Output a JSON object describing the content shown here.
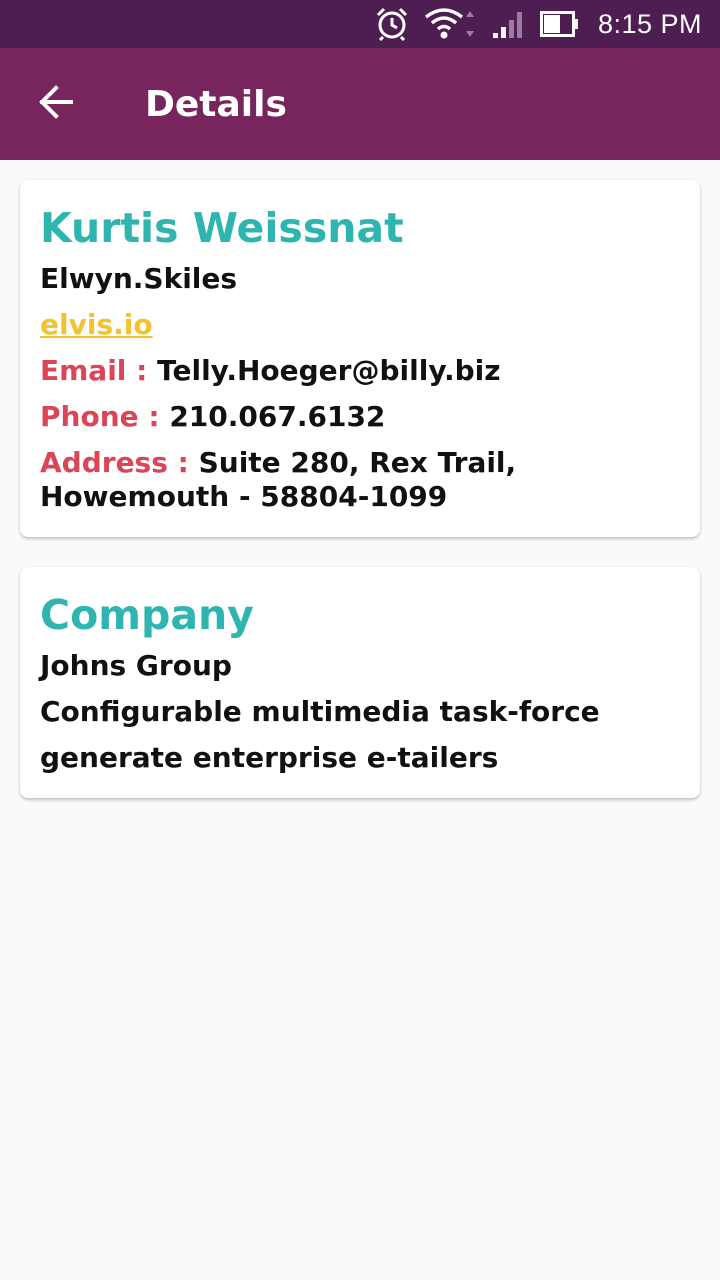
{
  "status_bar": {
    "time": "8:15 PM",
    "icons": [
      "alarm-icon",
      "wifi-icon",
      "cell-signal-icon",
      "battery-icon"
    ]
  },
  "app_bar": {
    "back_icon": "arrow-back-icon",
    "title": "Details"
  },
  "contact": {
    "name": "Kurtis Weissnat",
    "username": "Elwyn.Skiles",
    "website": "elvis.io",
    "email_label": "Email :",
    "email": "Telly.Hoeger@billy.biz",
    "phone_label": "Phone :",
    "phone": "210.067.6132",
    "address_label": "Address :",
    "address": "Suite 280, Rex Trail, Howemouth - 58804-1099"
  },
  "company": {
    "heading": "Company",
    "name": "Johns Group",
    "catch_phrase": "Configurable multimedia task-force",
    "bs": "generate enterprise e-tailers"
  },
  "colors": {
    "status_bar": "#4e1e52",
    "app_bar": "#77255c",
    "accent_title": "#2fb5b0",
    "label": "#dc4457",
    "link": "#f2c231",
    "background": "#fafafa"
  }
}
